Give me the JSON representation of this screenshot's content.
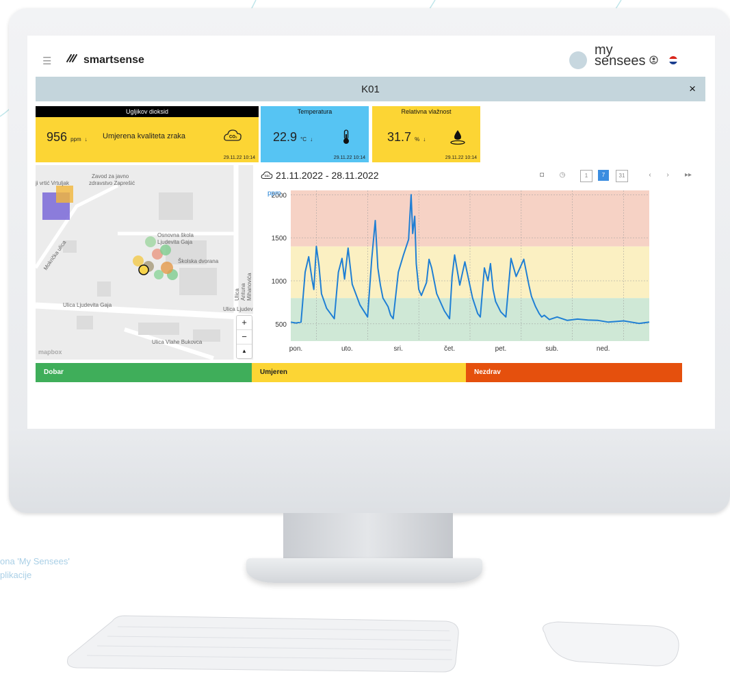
{
  "app": {
    "logo_text": "smartsense",
    "brand_line1": "my",
    "brand_line2": "sensees"
  },
  "title_bar": {
    "title": "K01",
    "close_label": "×"
  },
  "cards": [
    {
      "header": "Ugljikov dioksid",
      "value": "956",
      "unit": "ppm",
      "trend": "↓",
      "description": "Umjerena kvaliteta zraka",
      "timestamp": "29.11.22 10:14",
      "color": "#fcd534",
      "header_color": "#000000",
      "icon": "co2-cloud-icon"
    },
    {
      "header": "Temperatura",
      "value": "22.9",
      "unit": "°C",
      "trend": "↓",
      "timestamp": "29.11.22 10:14",
      "color": "#56c4f3",
      "header_color": "#56c4f3",
      "icon": "thermometer-icon"
    },
    {
      "header": "Relativna vlažnost",
      "value": "31.7",
      "unit": "%",
      "trend": "↓",
      "timestamp": "29.11.22 10:14",
      "color": "#fcd534",
      "header_color": "#fcd534",
      "icon": "water-drop-icon"
    }
  ],
  "map": {
    "labels": [
      "Zavod za javno",
      "zdravstvo Zaprešić",
      "ji vrtić Vrtuljak",
      "Osnovna škola",
      "Ljudevita Gaja",
      "Školska dvorana",
      "Ulica Antuna Mihanovića",
      "Ulica Ljudevita Gaja",
      "Ulica Ljudev",
      "Ulica Vlahe Bukovca",
      "Mokrička ulica"
    ],
    "zoom_in": "+",
    "zoom_out": "−",
    "compass": "▲",
    "attribution": "mapbox"
  },
  "chart_header": {
    "date_range": "21.11.2022 - 28.11.2022",
    "toolbar_icons": [
      "camera-icon",
      "clock-icon",
      "day-view-icon",
      "week-view-icon",
      "month-view-icon",
      "prev-icon",
      "next-icon",
      "fast-forward-icon"
    ]
  },
  "chart_data": {
    "type": "line",
    "unit_label": "ppm",
    "ylim": [
      300,
      2050
    ],
    "yticks": [
      500,
      1000,
      1500,
      2000
    ],
    "xticks": [
      "pon.",
      "uto.",
      "sri.",
      "čet.",
      "pet.",
      "sub.",
      "ned."
    ],
    "bands": [
      {
        "from": 300,
        "to": 800,
        "color": "#cfe8d6"
      },
      {
        "from": 800,
        "to": 1400,
        "color": "#fbf0c2"
      },
      {
        "from": 1400,
        "to": 2050,
        "color": "#f6d2c5"
      }
    ],
    "grid": true,
    "series": [
      {
        "color": "#1f7fd4",
        "x": [
          0,
          0.1,
          0.2,
          0.28,
          0.35,
          0.42,
          0.45,
          0.5,
          0.55,
          0.6,
          0.7,
          0.85,
          0.93,
          1.0,
          1.05,
          1.12,
          1.2,
          1.35,
          1.5,
          1.58,
          1.65,
          1.7,
          1.75,
          1.8,
          1.9,
          1.95,
          2.0,
          2.1,
          2.2,
          2.3,
          2.35,
          2.38,
          2.42,
          2.45,
          2.5,
          2.55,
          2.65,
          2.7,
          2.75,
          2.8,
          2.85,
          3.0,
          3.1,
          3.15,
          3.2,
          3.3,
          3.4,
          3.55,
          3.65,
          3.7,
          3.78,
          3.85,
          3.9,
          3.95,
          4.0,
          4.1,
          4.2,
          4.3,
          4.4,
          4.55,
          4.65,
          4.7,
          4.78,
          4.85,
          4.9,
          4.95,
          5.05,
          5.2,
          5.4,
          5.6,
          5.8,
          6.0,
          6.2,
          6.5,
          6.8,
          7.0
        ],
        "y": [
          520,
          510,
          520,
          1100,
          1280,
          1000,
          900,
          1400,
          1180,
          850,
          680,
          560,
          1100,
          1260,
          1020,
          1380,
          960,
          720,
          580,
          1250,
          1700,
          1150,
          950,
          800,
          700,
          600,
          560,
          1100,
          1300,
          1480,
          2000,
          1550,
          1750,
          1200,
          900,
          830,
          980,
          1250,
          1150,
          1000,
          850,
          650,
          560,
          1050,
          1300,
          950,
          1220,
          800,
          620,
          580,
          1150,
          1000,
          1200,
          900,
          760,
          640,
          580,
          1260,
          1050,
          1250,
          950,
          820,
          700,
          620,
          580,
          600,
          550,
          580,
          540,
          555,
          545,
          540,
          520,
          535,
          505,
          520
        ]
      }
    ]
  },
  "legend": {
    "good": "Dobar",
    "moderate": "Umjeren",
    "unhealthy": "Nezdrav",
    "good_color": "#3fae5a",
    "moderate_color": "#fcd534",
    "unhealthy_color": "#e5500d"
  },
  "caption": {
    "line1": "ona  'My Sensees'",
    "line2": "plikacije"
  }
}
